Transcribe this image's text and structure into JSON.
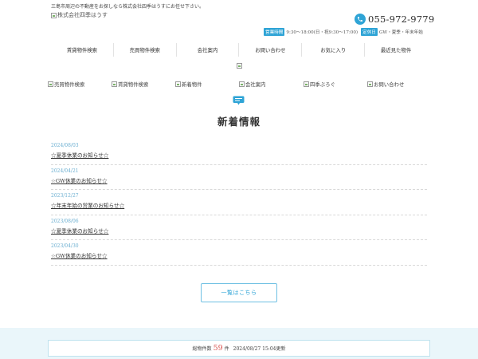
{
  "header": {
    "tagline": "三島市周辺の不動産をお探しなら株式会社四季はうすにお任せ下さい。",
    "logo_alt": "株式会社四季はうす",
    "phone": "055-972-9779",
    "hours_tag": "営業時間",
    "hours_text": "9:30～18:00(日・祝9:30～17:00)",
    "closed_tag": "定休日",
    "closed_text": "GW・夏季・年末年始"
  },
  "gnav": {
    "items": [
      {
        "label": "賃貸物件検索"
      },
      {
        "label": "売買物件検索"
      },
      {
        "label": "会社案内"
      },
      {
        "label": "お問い合わせ"
      },
      {
        "label": "お気に入り"
      },
      {
        "label": "最近見た物件"
      }
    ]
  },
  "subnav": {
    "items": [
      {
        "label": "売買物件検索"
      },
      {
        "label": "賃貸物件検索"
      },
      {
        "label": "新着物件"
      },
      {
        "label": "会社案内"
      },
      {
        "label": "四季ぶろぐ"
      },
      {
        "label": "お問い合わせ"
      }
    ]
  },
  "news": {
    "title": "新着情報",
    "items": [
      {
        "date": "2024/08/03",
        "title": "☆夏季休業のお知らせ☆"
      },
      {
        "date": "2024/04/21",
        "title": "☆GW休業のお知らせ☆"
      },
      {
        "date": "2023/12/27",
        "title": "☆年末年始の営業のお知らせ☆"
      },
      {
        "date": "2023/08/06",
        "title": "☆夏季休業のお知らせ☆"
      },
      {
        "date": "2023/04/30",
        "title": "☆GW休業のお知らせ☆"
      }
    ],
    "more_label": "一覧はこちら"
  },
  "footer": {
    "count_label": "総物件数",
    "count_value": "59",
    "count_unit": "件",
    "updated": "2024/08/27 15:04更新"
  },
  "colors": {
    "accent": "#2fa4d6",
    "date": "#6aaed0",
    "count": "#d9534f",
    "band": "#eaf6fa"
  }
}
